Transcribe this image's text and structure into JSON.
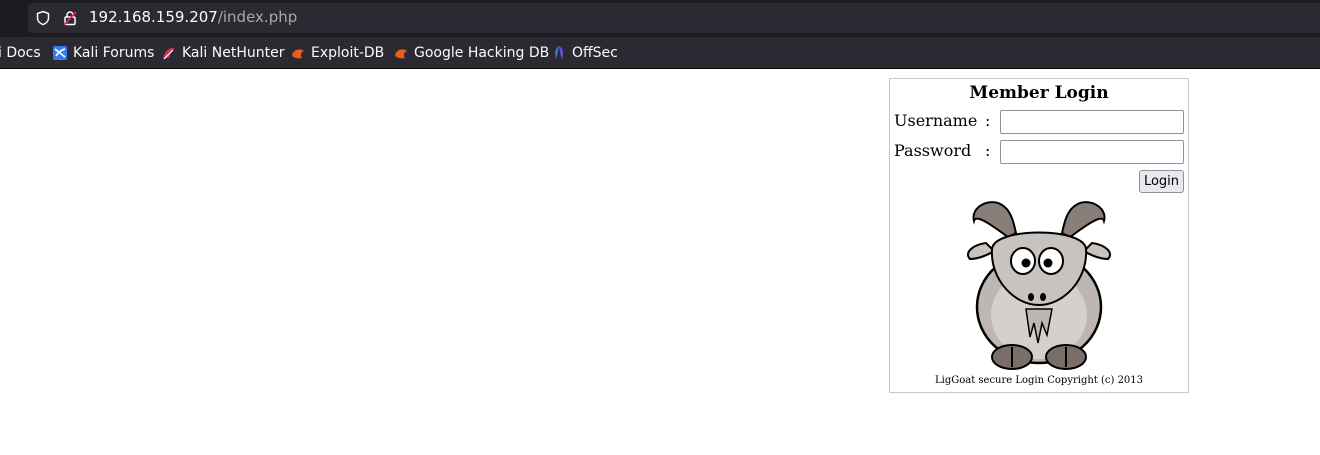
{
  "browser": {
    "url_host": "192.168.159.207",
    "url_path": "/index.php",
    "bookmarks": [
      {
        "label": "i Docs",
        "icon": "kali-docs-icon"
      },
      {
        "label": "Kali Forums",
        "icon": "kali-forums-icon"
      },
      {
        "label": "Kali NetHunter",
        "icon": "kali-nethunter-icon"
      },
      {
        "label": "Exploit-DB",
        "icon": "exploit-db-icon"
      },
      {
        "label": "Google Hacking DB",
        "icon": "ghdb-icon"
      },
      {
        "label": "OffSec",
        "icon": "offsec-icon"
      }
    ]
  },
  "login": {
    "title": "Member Login",
    "username_label": "Username",
    "password_label": "Password",
    "colon": ":",
    "username_value": "",
    "password_value": "",
    "button_label": "Login",
    "image": "goat-mascot",
    "copyright": "LigGoat secure Login Copyright (c) 2013"
  }
}
